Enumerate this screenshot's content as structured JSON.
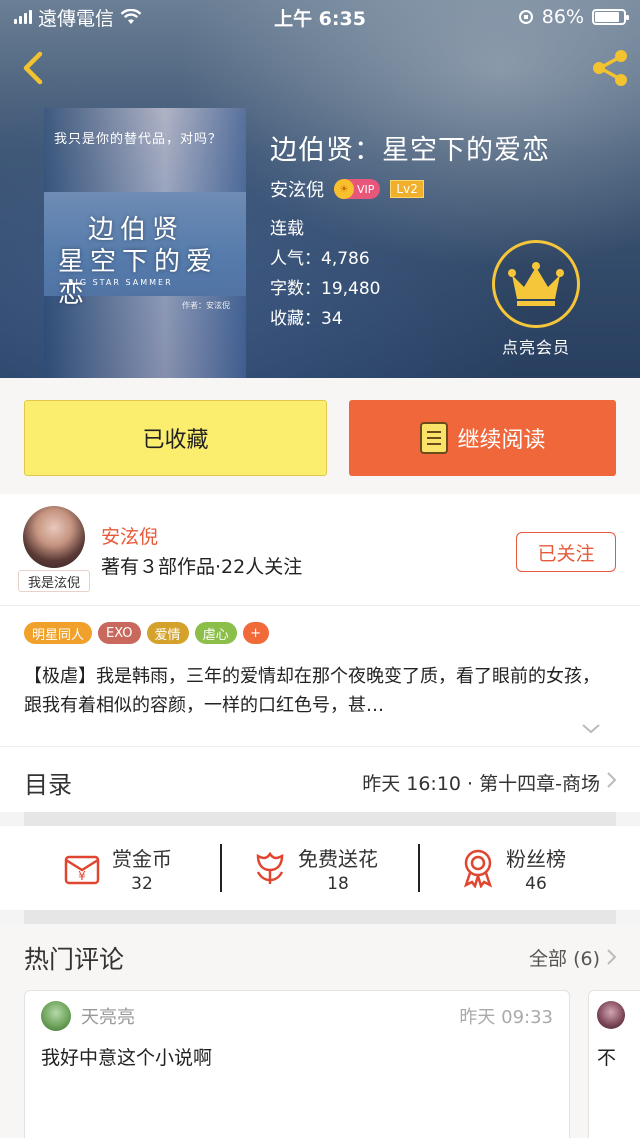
{
  "status": {
    "carrier": "遠傳電信",
    "time": "上午 6:35",
    "battery": "86%",
    "battery_level": 0.86
  },
  "book": {
    "title": "边伯贤：星空下的爱恋",
    "author": "安泫倪",
    "vip": "VIP",
    "level": "Lv2",
    "status": "连载",
    "popularity": "人气：4,786",
    "words": "字数：19,480",
    "favorites": "收藏：34",
    "cover": {
      "tagline": "我只是你的替代品，对吗？",
      "title_line1": "边伯贤",
      "title_line2": "星空下的爱恋",
      "subtitle_en": "BIG STAR SAMMER",
      "author_credit": "作者：安泫倪"
    }
  },
  "member": {
    "label": "点亮会员"
  },
  "actions": {
    "collected": "已收藏",
    "continue_read": "继续阅读"
  },
  "author_card": {
    "name": "安泫倪",
    "stats": "著有３部作品·22人关注",
    "avatar_tag": "我是泫倪",
    "follow": "已关注"
  },
  "tags": [
    {
      "label": "明星同人",
      "color": "#f0a12c"
    },
    {
      "label": "EXO",
      "color": "#c9695d"
    },
    {
      "label": "爱情",
      "color": "#d4a12a"
    },
    {
      "label": "虐心",
      "color": "#8cbf4a"
    },
    {
      "label": "+",
      "color": "#f06a3a"
    }
  ],
  "summary": "【极虐】我是韩雨，三年的爱情却在那个夜晚变了质，看了眼前的女孩，跟我有着相似的容颜，一样的口红色号，甚…",
  "toc": {
    "title": "目录",
    "latest": "昨天 16:10 · 第十四章-商场"
  },
  "rewards": [
    {
      "label": "赏金币",
      "count": "32",
      "icon": "coin-envelope-icon"
    },
    {
      "label": "免费送花",
      "count": "18",
      "icon": "flower-icon"
    },
    {
      "label": "粉丝榜",
      "count": "46",
      "icon": "medal-icon"
    }
  ],
  "comments": {
    "title": "热门评论",
    "all": "全部 (6)",
    "items": [
      {
        "name": "天亮亮",
        "time": "昨天 09:33",
        "text": "我好中意这个小说啊"
      },
      {
        "text": "不"
      }
    ]
  }
}
